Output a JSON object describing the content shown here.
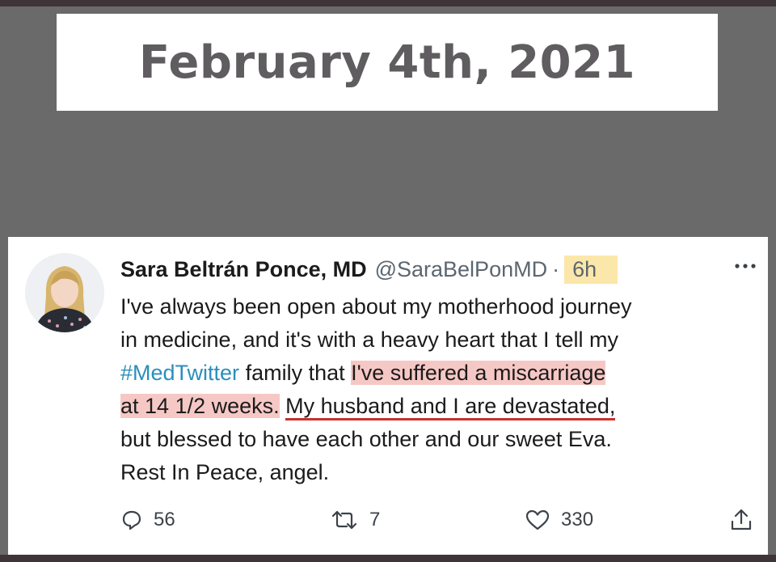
{
  "banner": {
    "date": "February 4th, 2021"
  },
  "tweet": {
    "author_name": "Sara Beltrán Ponce, MD",
    "handle": "@SaraBelPonMD",
    "separator": "·",
    "time": "6h",
    "line1": "I've always been open about my motherhood journey",
    "line2": "in medicine, and it's with a heavy heart that I tell my",
    "hashtag": "#MedTwitter",
    "line3_mid": " family that ",
    "highlight1": "I've suffered a miscarriage",
    "highlight2": "at 14 1/2 weeks.",
    "line4_gap": " ",
    "underlined": "My husband and I are devastated,",
    "line5": "but blessed to have each other and our sweet Eva.",
    "line6": "Rest In Peace, angel."
  },
  "actions": {
    "replies": "56",
    "retweets": "7",
    "likes": "330"
  },
  "colors": {
    "background": "#6b6a6b",
    "hashtag": "#2a8fbd",
    "highlight_red": "#f6c8c5",
    "highlight_yellow": "#fbe7a9",
    "underline": "#c9302c"
  },
  "icons": [
    "avatar-photo",
    "more-icon",
    "reply-icon",
    "retweet-icon",
    "like-icon",
    "share-icon"
  ]
}
